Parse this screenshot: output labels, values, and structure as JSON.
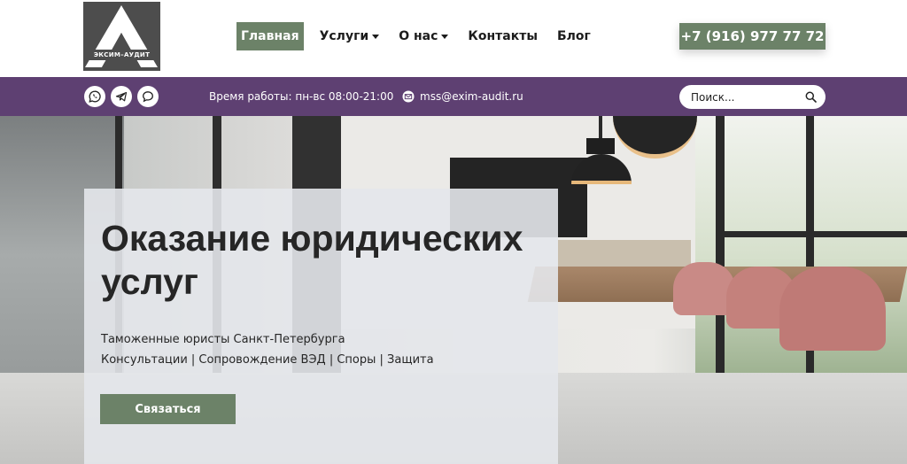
{
  "logo": {
    "text": "ЭКСИМ–АУДИТ"
  },
  "nav": {
    "items": [
      {
        "label": "Главная",
        "active": true,
        "dropdown": false
      },
      {
        "label": "Услуги",
        "active": false,
        "dropdown": true
      },
      {
        "label": "О нас",
        "active": false,
        "dropdown": true
      },
      {
        "label": "Контакты",
        "active": false,
        "dropdown": false
      },
      {
        "label": "Блог",
        "active": false,
        "dropdown": false
      }
    ]
  },
  "phone": "+7 (916) 977 77 72",
  "topbar": {
    "social": [
      "whatsapp-icon",
      "telegram-icon",
      "chat-icon"
    ],
    "hours": "Время работы: пн-вс 08:00-21:00",
    "email": "mss@exim-audit.ru"
  },
  "search": {
    "placeholder": "Поиск..."
  },
  "hero": {
    "title": "Оказание юридических услуг",
    "subtitle_1": "Таможенные юристы Санкт-Петербурга",
    "subtitle_2": "Консультации | Сопровождение ВЭД | Споры | Защита",
    "button": "Связаться"
  },
  "colors": {
    "accent_green": "#6c8268",
    "topbar_purple": "#5e4072",
    "logo_gray": "#4d4d4d"
  }
}
